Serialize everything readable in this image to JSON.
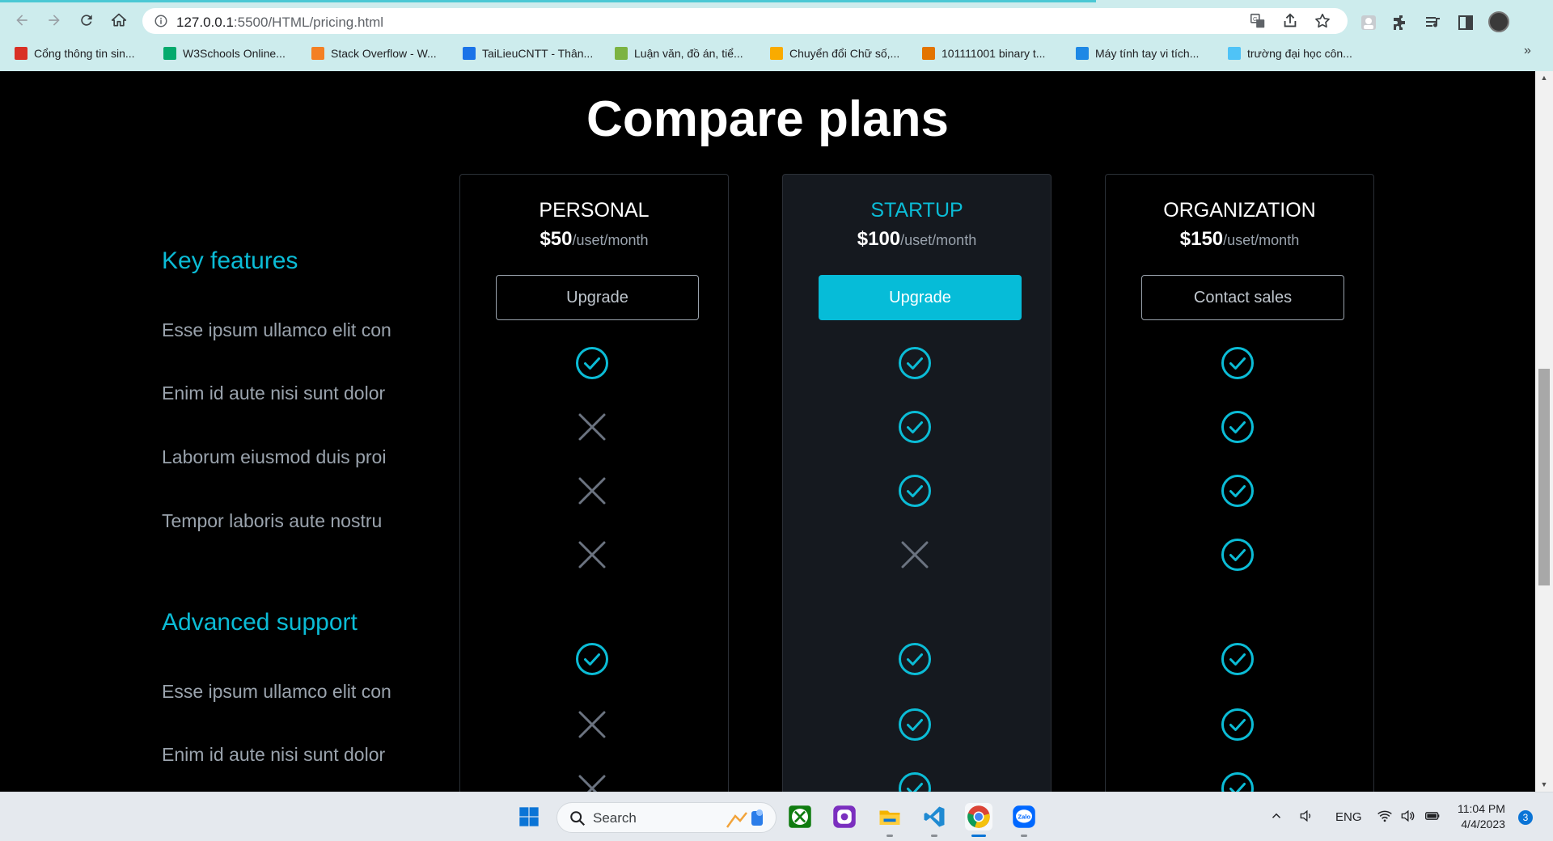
{
  "browser": {
    "url_host": "127.0.0.1",
    "url_path": ":5500/HTML/pricing.html",
    "bookmarks": [
      {
        "label": "Cổng thông tin sin...",
        "color": "#d93025"
      },
      {
        "label": "W3Schools Online...",
        "color": "#04aa6d"
      },
      {
        "label": "Stack Overflow - W...",
        "color": "#f48024"
      },
      {
        "label": "TaiLieuCNTT - Thân...",
        "color": "#1a73e8"
      },
      {
        "label": "Luận văn, đồ án, tiể...",
        "color": "#7cb342"
      },
      {
        "label": "Chuyển đổi Chữ số,...",
        "color": "#f9ab00"
      },
      {
        "label": "101111001 binary t...",
        "color": "#e37400"
      },
      {
        "label": "Máy tính tay vi tích...",
        "color": "#1e88e5"
      },
      {
        "label": "trường đại học côn...",
        "color": "#4fc3f7"
      }
    ],
    "more_label": "»"
  },
  "page": {
    "title": "Compare plans",
    "sections": [
      {
        "title": "Key features",
        "features": [
          "Esse ipsum ullamco elit con",
          "Enim id aute nisi sunt dolor",
          "Laborum eiusmod duis proi",
          "Tempor laboris aute nostru"
        ]
      },
      {
        "title": "Advanced support",
        "features": [
          "Esse ipsum ullamco elit con",
          "Enim id aute nisi sunt dolor"
        ]
      }
    ],
    "plans": [
      {
        "name": "PERSONAL",
        "price": "$50",
        "unit": "/uset/month",
        "button": "Upgrade",
        "featured": false,
        "marks": [
          "check",
          "cross",
          "cross",
          "cross",
          "check",
          "cross",
          "cross"
        ]
      },
      {
        "name": "STARTUP",
        "price": "$100",
        "unit": "/uset/month",
        "button": "Upgrade",
        "featured": true,
        "marks": [
          "check",
          "check",
          "check",
          "cross",
          "check",
          "check",
          "check"
        ]
      },
      {
        "name": "ORGANIZATION",
        "price": "$150",
        "unit": "/uset/month",
        "button": "Contact sales",
        "featured": false,
        "marks": [
          "check",
          "check",
          "check",
          "check",
          "check",
          "check",
          "check"
        ]
      }
    ],
    "colors": {
      "accent": "#0bbcd6",
      "cross": "#6b7380"
    }
  },
  "taskbar": {
    "search_label": "Search",
    "language": "ENG",
    "time": "11:04 PM",
    "date": "4/4/2023",
    "notifications": "3"
  }
}
